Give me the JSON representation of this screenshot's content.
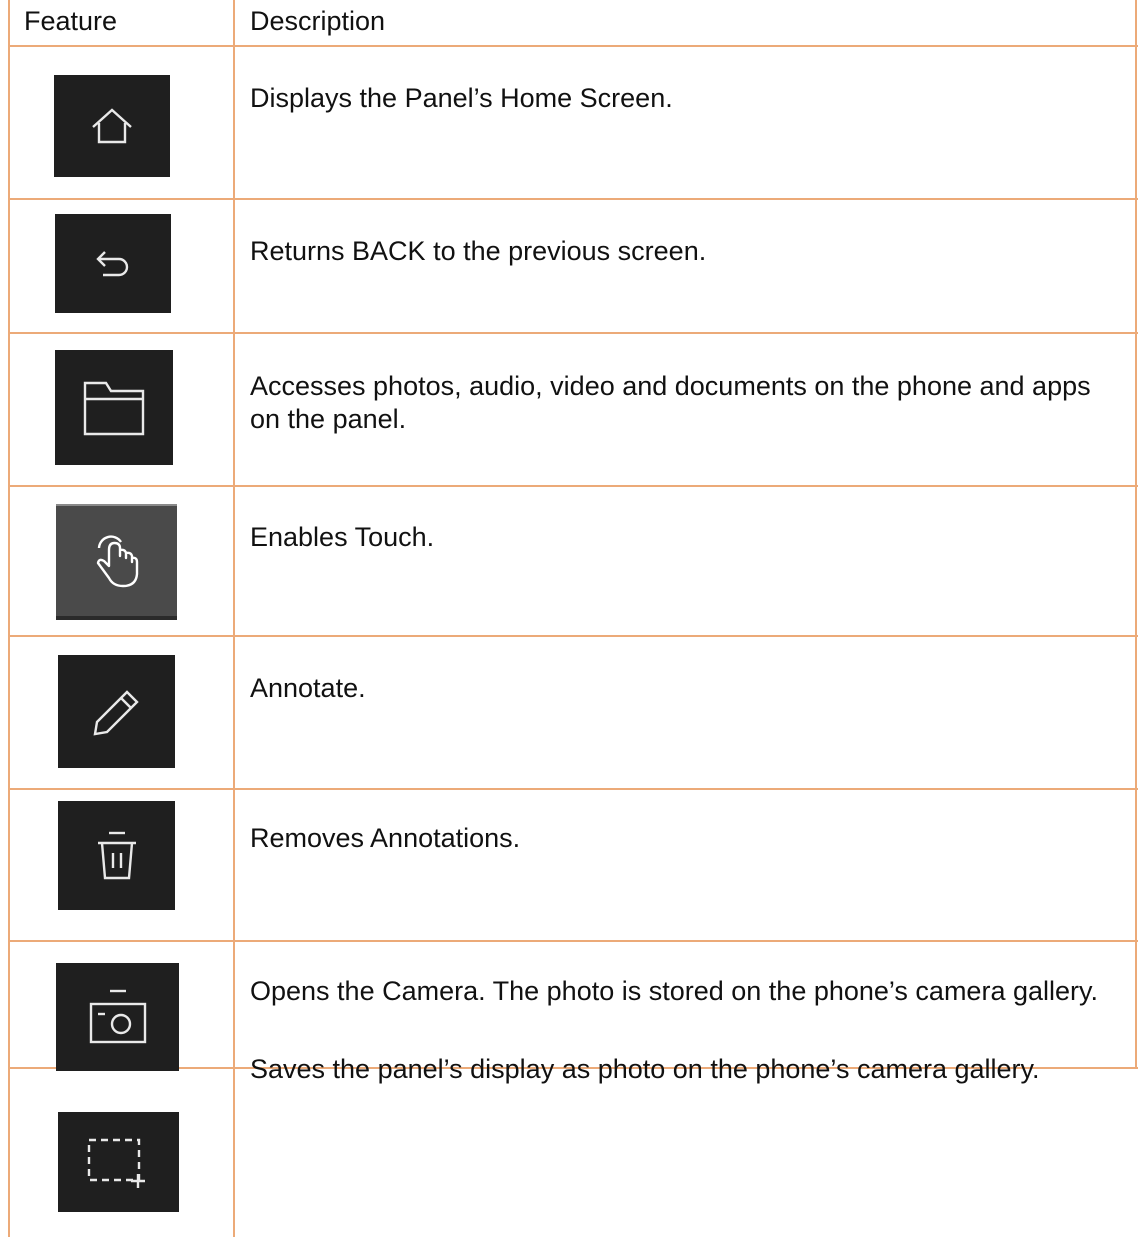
{
  "table": {
    "headers": {
      "feature": "Feature",
      "description": "Description"
    },
    "rows": [
      {
        "icon": "home-icon",
        "description": "Displays the Panel’s Home Screen."
      },
      {
        "icon": "back-icon",
        "description": "Returns BACK to the previous screen."
      },
      {
        "icon": "folder-icon",
        "description": "Accesses photos, audio, video and documents on the phone and apps on the panel."
      },
      {
        "icon": "touch-icon",
        "description": "Enables Touch."
      },
      {
        "icon": "pencil-icon",
        "description": "Annotate."
      },
      {
        "icon": "trash-icon",
        "description": "Removes Annotations."
      },
      {
        "icon": "camera-icon",
        "description": "Opens the Camera. The photo is stored on the phone’s camera gallery."
      },
      {
        "icon": "screenshot-icon",
        "description": "Saves the panel’s display as photo on the phone’s camera gallery."
      }
    ]
  },
  "colors": {
    "border": "#ecaa78",
    "icon_bg": "#1f1f1f",
    "touch_bg": "#4a4a4a"
  }
}
